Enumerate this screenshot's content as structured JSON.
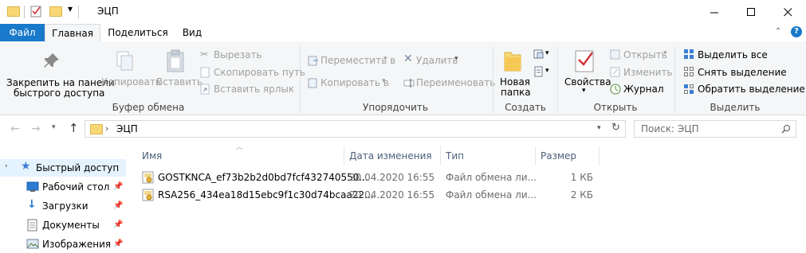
{
  "window": {
    "title": "ЭЦП",
    "minimize": "—",
    "maximize": "☐",
    "close": "✕"
  },
  "ribbon_tabs": {
    "file": "Файл",
    "home": "Главная",
    "share": "Поделиться",
    "view": "Вид"
  },
  "ribbon": {
    "pin_line1": "Закрепить на панели",
    "pin_line2": "быстрого доступа",
    "copy": "Копировать",
    "paste": "Вставить",
    "cut": "Вырезать",
    "copy_path": "Скопировать путь",
    "paste_shortcut": "Вставить ярлык",
    "clipboard_group": "Буфер обмена",
    "move_to": "Переместить в",
    "copy_to": "Копировать в",
    "delete": "Удалить",
    "rename": "Переименовать",
    "organize_group": "Упорядочить",
    "new_folder_line1": "Новая",
    "new_folder_line2": "папка",
    "create_group": "Создать",
    "properties": "Свойства",
    "open": "Открыть",
    "edit": "Изменить",
    "history": "Журнал",
    "open_group": "Открыть",
    "select_all": "Выделить все",
    "select_none": "Снять выделение",
    "invert_selection": "Обратить выделение",
    "select_group": "Выделить"
  },
  "address": {
    "path": "ЭЦП",
    "search_placeholder": "Поиск: ЭЦП"
  },
  "columns": {
    "name": "Имя",
    "date": "Дата изменения",
    "type": "Тип",
    "size": "Размер"
  },
  "files": [
    {
      "name": "GOSTKNCA_ef73b2b2d0bd7fcf432740550...",
      "date": "20.04.2020 16:55",
      "type": "Файл обмена ли...",
      "size": "1 КБ"
    },
    {
      "name": "RSA256_434ea18d15ebc9f1c30d74bcaa22...",
      "date": "20.04.2020 16:55",
      "type": "Файл обмена ли...",
      "size": "2 КБ"
    }
  ],
  "nav": {
    "quick_access": "Быстрый доступ",
    "items": [
      "Рабочий стол",
      "Загрузки",
      "Документы",
      "Изображения"
    ]
  },
  "colors": {
    "file_tab": "#1979ca",
    "ribbon_bg": "#f5f6f7",
    "selected_nav": "#e5f3ff",
    "header_text": "#4c607a"
  }
}
